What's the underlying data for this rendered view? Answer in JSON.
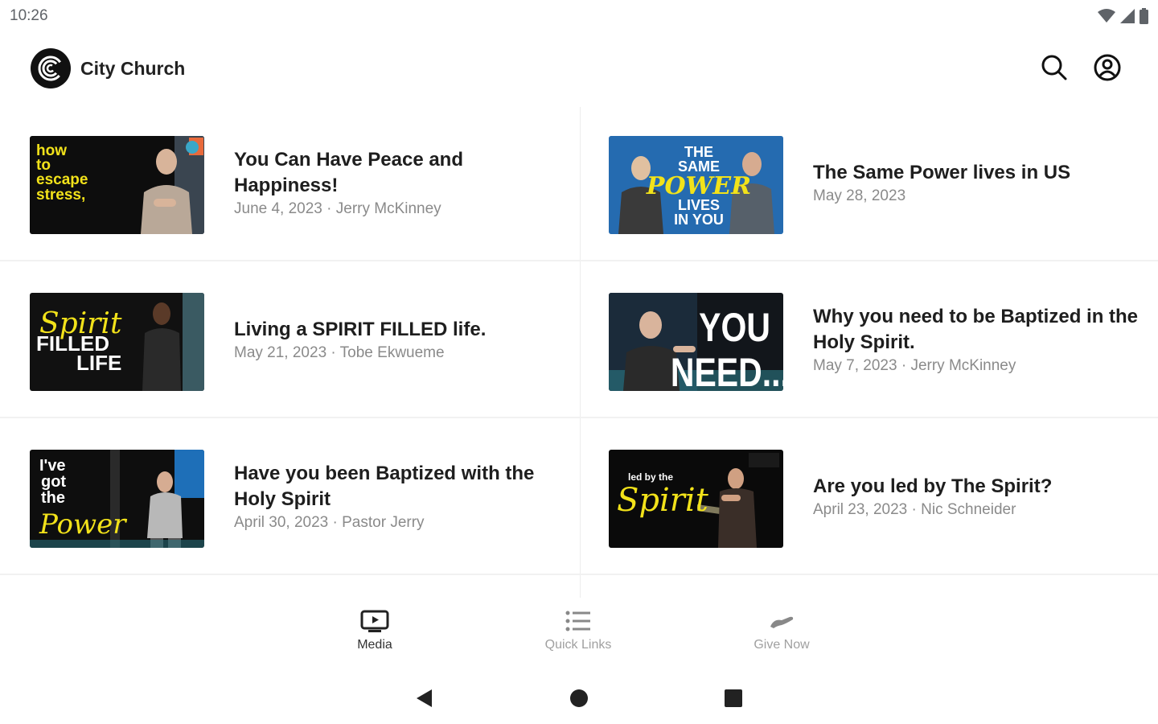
{
  "status_bar": {
    "time": "10:26",
    "icons": [
      "wifi-icon",
      "cellular-signal-icon",
      "battery-icon"
    ]
  },
  "header": {
    "app_name": "City Church",
    "logo": "city-church-logo-icon",
    "actions": [
      "search-icon",
      "account-icon"
    ]
  },
  "media": [
    {
      "title": "You Can Have Peace and Happiness!",
      "meta": "June 4, 2023 · Jerry McKinney",
      "thumb_text": [
        "how",
        "to",
        "escape",
        "stress,"
      ]
    },
    {
      "title": "The Same Power lives in US",
      "meta": "May 28, 2023",
      "thumb_text": [
        "THE",
        "SAME",
        "POWER",
        "LIVES",
        "IN YOU"
      ]
    },
    {
      "title": "Living a SPIRIT FILLED life.",
      "meta": "May 21, 2023 · Tobe Ekwueme",
      "thumb_text": [
        "Spirit",
        "FILLED",
        "LIFE"
      ]
    },
    {
      "title": "Why you need to be Baptized in the Holy Spirit.",
      "meta": "May 7, 2023 · Jerry McKinney",
      "thumb_text": [
        "YOU",
        "NEED..."
      ]
    },
    {
      "title": "Have you been Baptized with the Holy Spirit",
      "meta": "April 30, 2023 · Pastor Jerry",
      "thumb_text": [
        "I've",
        "got",
        "the",
        "Power"
      ]
    },
    {
      "title": "Are you led by The Spirit?",
      "meta": "April 23, 2023 · Nic Schneider",
      "thumb_text": [
        "led by the",
        "Spirit"
      ]
    }
  ],
  "bottom_nav": [
    {
      "label": "Media",
      "icon": "media-tv-icon",
      "active": true
    },
    {
      "label": "Quick Links",
      "icon": "list-icon",
      "active": false
    },
    {
      "label": "Give Now",
      "icon": "give-hand-icon",
      "active": false
    }
  ],
  "colors": {
    "accent_yellow": "#f2e21a",
    "text_primary": "#1e1e1e",
    "text_secondary": "#8a8a8a"
  }
}
